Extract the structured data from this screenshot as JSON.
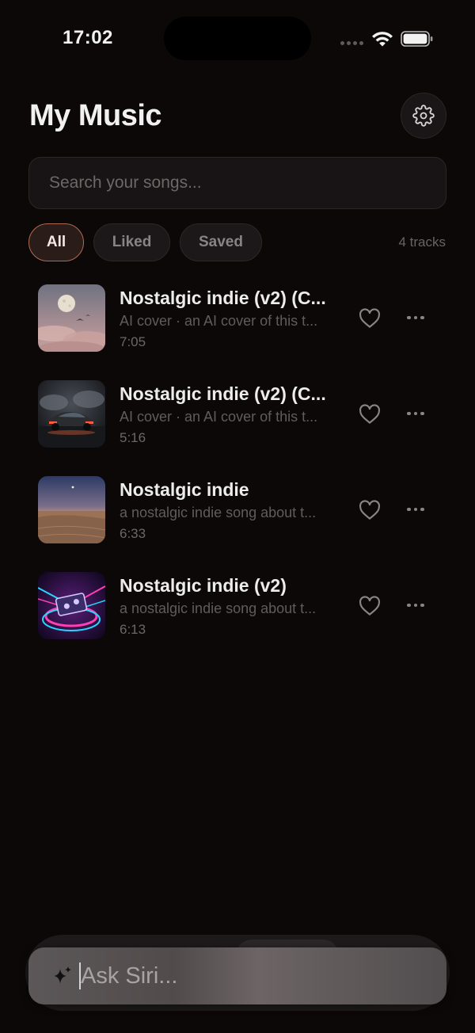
{
  "status_bar": {
    "time": "17:02"
  },
  "header": {
    "title": "My Music"
  },
  "search": {
    "placeholder": "Search your songs..."
  },
  "filters": [
    {
      "label": "All",
      "active": true
    },
    {
      "label": "Liked",
      "active": false
    },
    {
      "label": "Saved",
      "active": false
    }
  ],
  "track_count": "4 tracks",
  "tracks": [
    {
      "title": "Nostalgic indie (v2) (C...",
      "subtitle": "AI cover · an AI cover of this t...",
      "duration": "7:05",
      "art": "moon-clouds-art"
    },
    {
      "title": "Nostalgic indie (v2) (C...",
      "subtitle": "AI cover · an AI cover of this t...",
      "duration": "5:16",
      "art": "sports-car-art"
    },
    {
      "title": "Nostalgic indie",
      "subtitle": "a nostalgic indie song about t...",
      "duration": "6:33",
      "art": "desert-dusk-art"
    },
    {
      "title": "Nostalgic indie (v2)",
      "subtitle": "a nostalgic indie song about t...",
      "duration": "6:13",
      "art": "neon-cassette-art"
    }
  ],
  "siri": {
    "placeholder": "Ask Siri..."
  },
  "colors": {
    "background": "#0c0808",
    "accent": "#b06a52",
    "surface": "#181314"
  }
}
